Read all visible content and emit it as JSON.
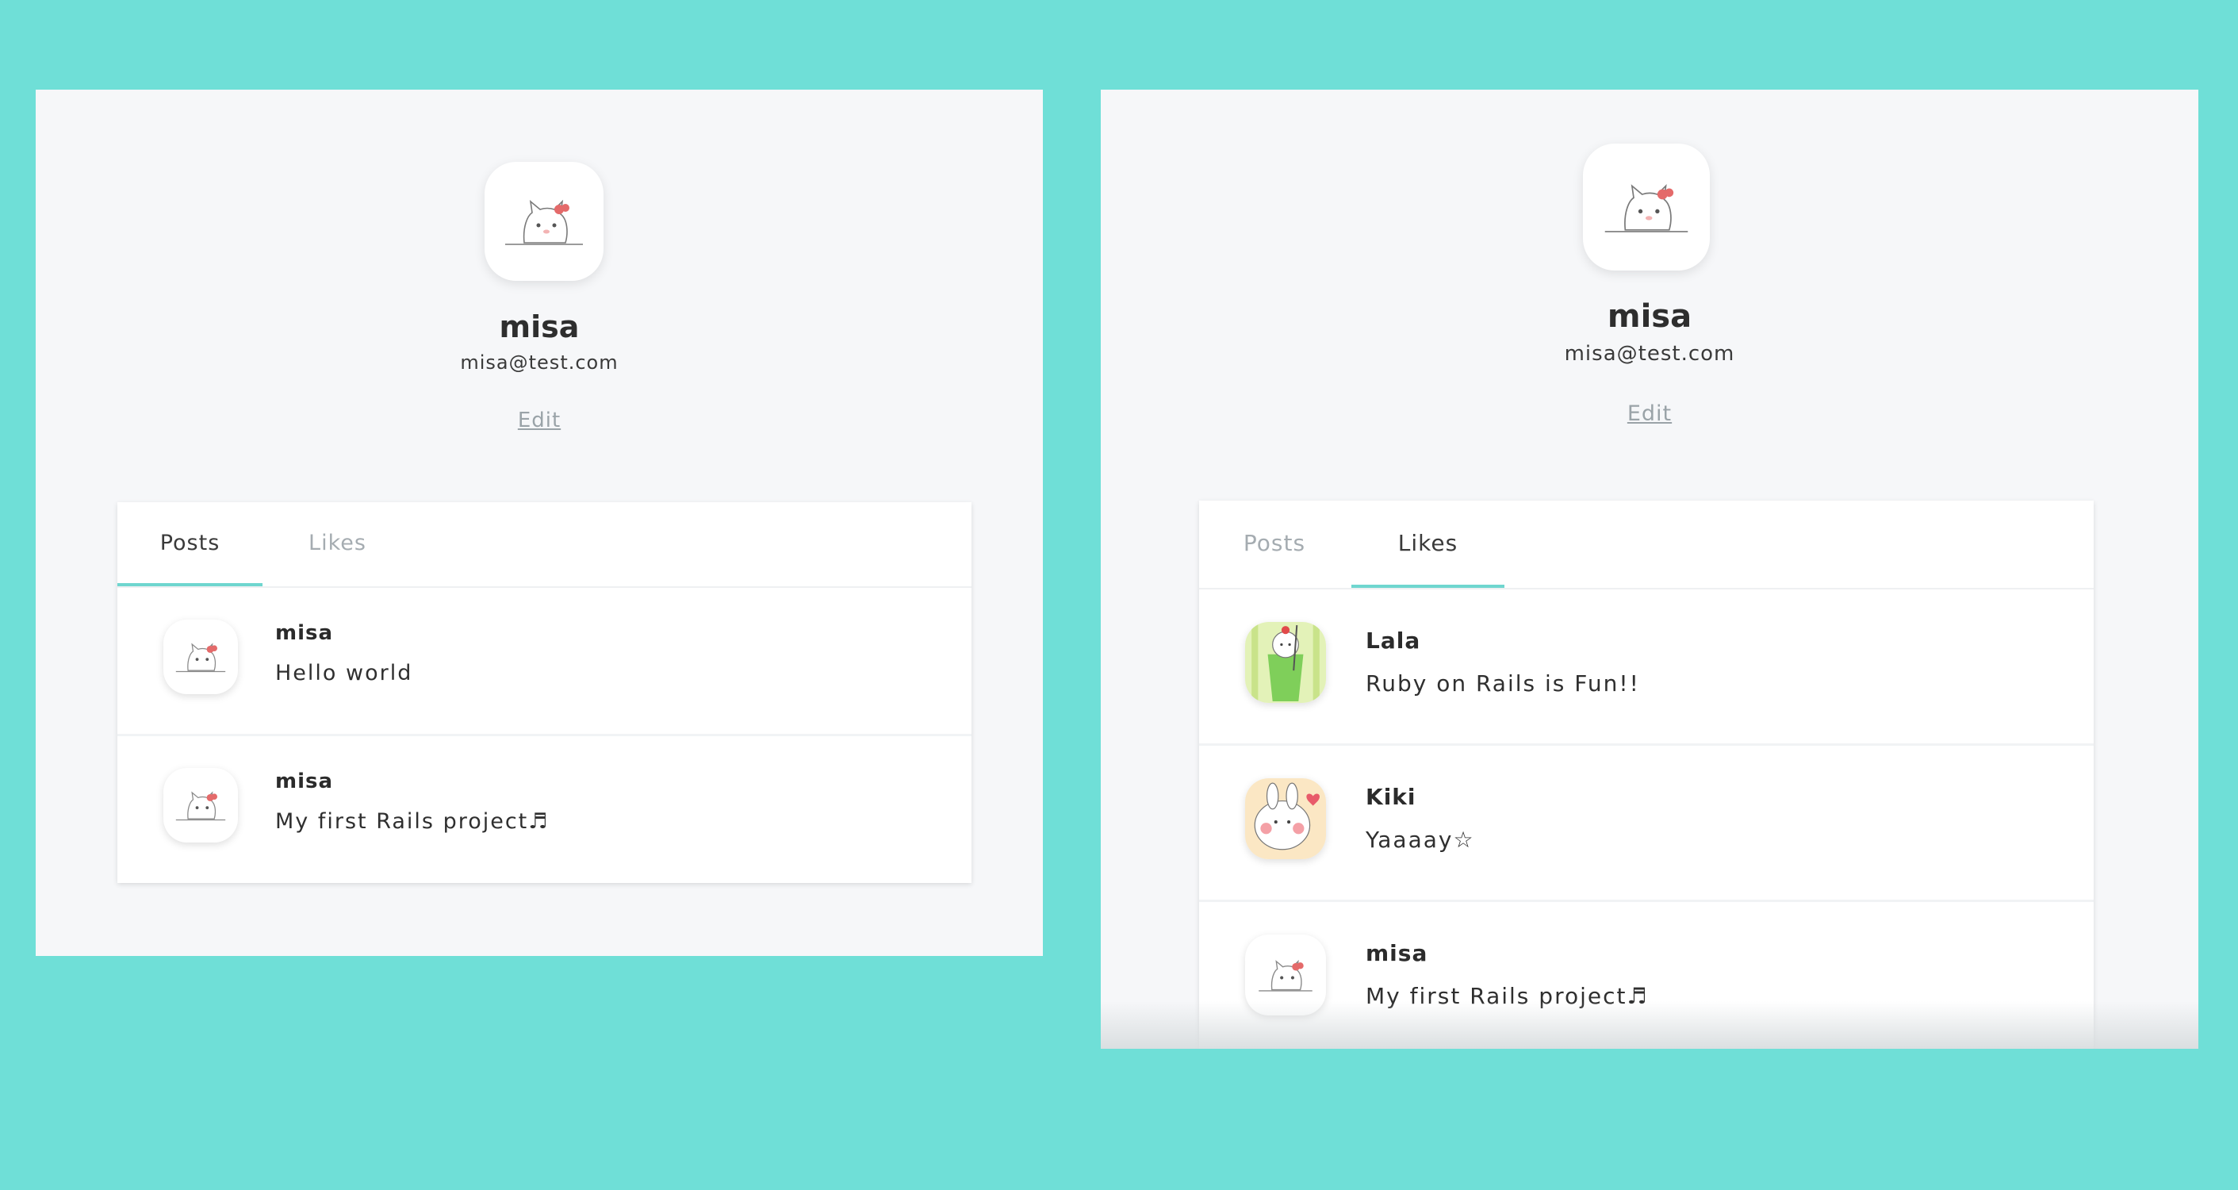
{
  "left_screen": {
    "profile": {
      "name": "misa",
      "email": "misa@test.com",
      "edit_label": "Edit"
    },
    "tabs": [
      {
        "label": "Posts",
        "active": true
      },
      {
        "label": "Likes",
        "active": false
      }
    ],
    "posts": [
      {
        "author": "misa",
        "text": "Hello world",
        "avatar": "cat-avatar-icon"
      },
      {
        "author": "misa",
        "text": "My first Rails project♬",
        "avatar": "cat-avatar-icon"
      }
    ]
  },
  "right_screen": {
    "profile": {
      "name": "misa",
      "email": "misa@test.com",
      "edit_label": "Edit"
    },
    "tabs": [
      {
        "label": "Posts",
        "active": false
      },
      {
        "label": "Likes",
        "active": true
      }
    ],
    "posts": [
      {
        "author": "Lala",
        "text": "Ruby on Rails is Fun!!",
        "avatar": "melon-soda-avatar-icon"
      },
      {
        "author": "Kiki",
        "text": "Yaaaay☆",
        "avatar": "bunny-avatar-icon"
      },
      {
        "author": "misa",
        "text": "My first Rails project♬",
        "avatar": "cat-avatar-icon"
      }
    ]
  },
  "colors": {
    "background": "#6fdfd7",
    "panel": "#f6f7f9",
    "tab_accent": "#6fd6cf"
  }
}
